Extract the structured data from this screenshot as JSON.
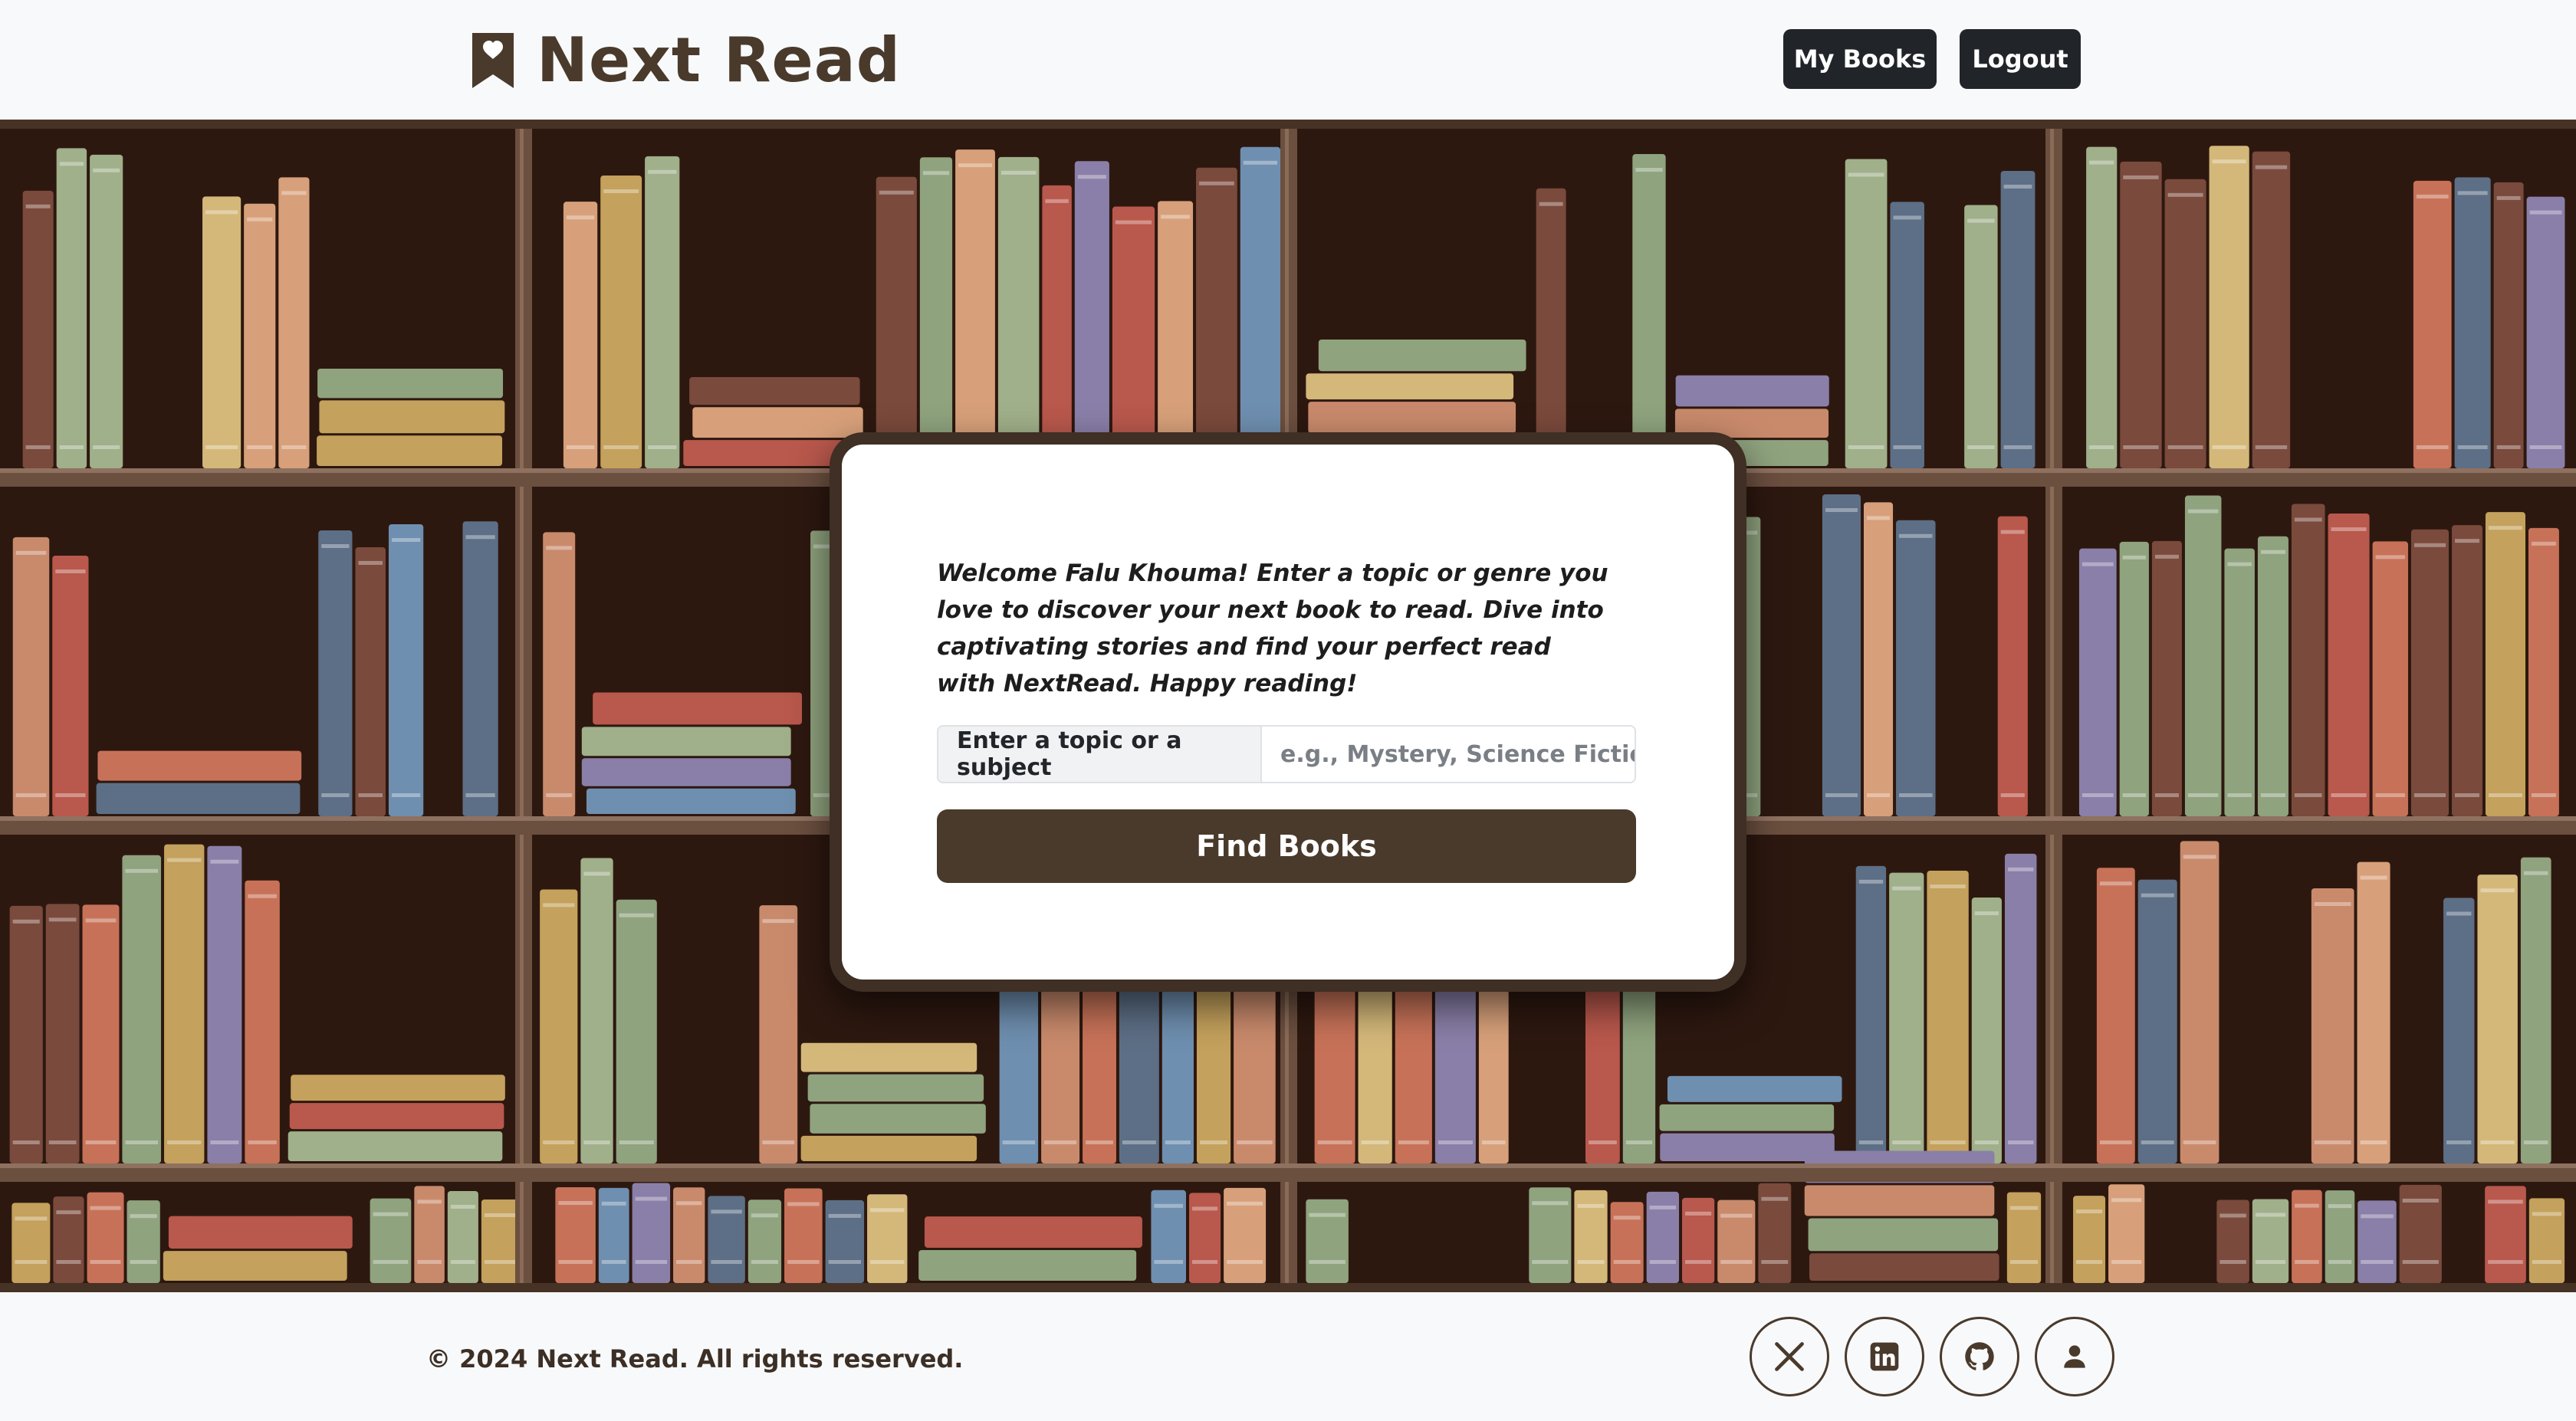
{
  "app": {
    "title": "Next Read"
  },
  "header": {
    "brand": "Next Read",
    "icons": {
      "logo": "bookmark-heart-icon"
    },
    "nav": {
      "my_books": "My Books",
      "logout": "Logout"
    }
  },
  "hero": {
    "background": "bookshelf-illustration"
  },
  "card": {
    "welcome": "Welcome Falu Khouma! Enter a topic or genre you love to discover your next book to read. Dive into captivating stories and find your perfect read with NextRead. Happy reading!",
    "input_label": "Enter a topic or a subject",
    "input_value": "",
    "input_placeholder": "e.g., Mystery, Science Fiction",
    "button_label": "Find Books"
  },
  "footer": {
    "copyright": "© 2024 Next Read. All rights reserved.",
    "social": [
      "x-icon",
      "linkedin-icon",
      "github-icon",
      "person-icon"
    ]
  },
  "colors": {
    "brand": "#4a3a2c",
    "nav_button": "#212529",
    "shelf_back": "#2d1810",
    "shelf_wood": "#6b4f3f",
    "card_border": "#3f2f24",
    "page_bg": "#f8f9fa"
  }
}
